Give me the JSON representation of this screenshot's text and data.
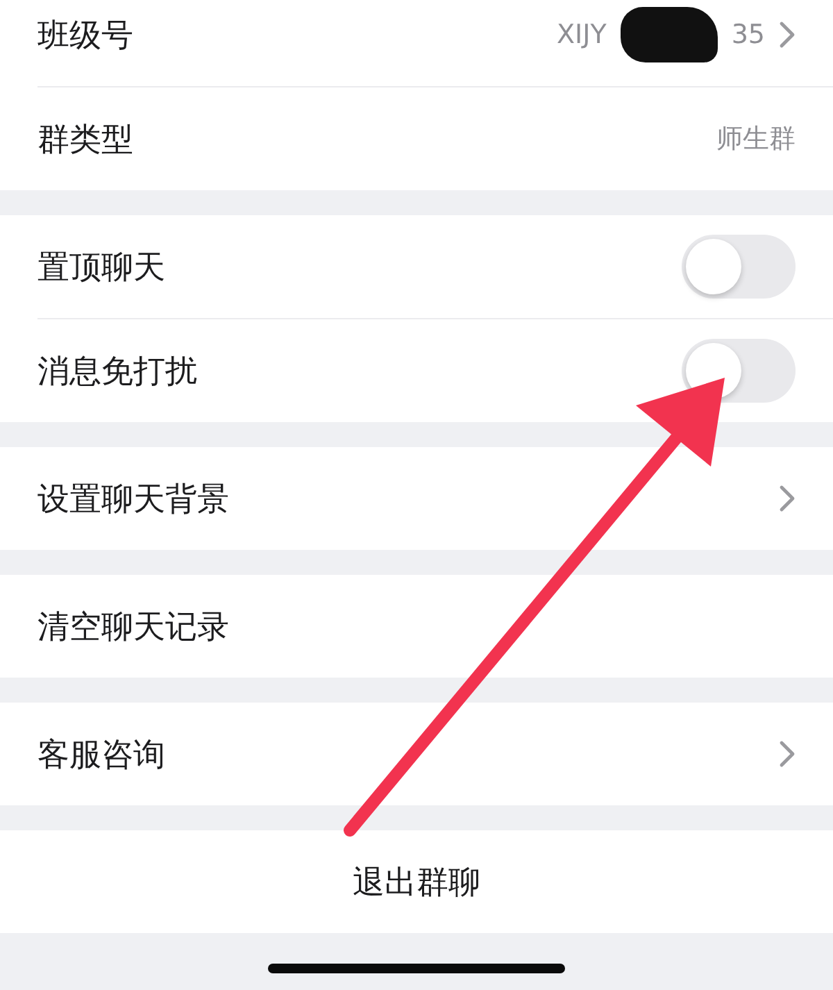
{
  "groups": [
    {
      "rows": [
        {
          "kind": "redacted",
          "label": "班级号",
          "value_start": "XIJY",
          "value_end": "35",
          "chevron": true
        },
        {
          "kind": "value",
          "label": "群类型",
          "value": "师生群",
          "chevron": false
        }
      ]
    },
    {
      "rows": [
        {
          "kind": "toggle",
          "label": "置顶聊天",
          "on": false
        },
        {
          "kind": "toggle",
          "label": "消息免打扰",
          "on": false
        }
      ]
    },
    {
      "rows": [
        {
          "kind": "value",
          "label": "设置聊天背景",
          "chevron": true
        }
      ]
    },
    {
      "rows": [
        {
          "kind": "value",
          "label": "清空聊天记录",
          "chevron": false
        }
      ]
    },
    {
      "rows": [
        {
          "kind": "value",
          "label": "客服咨询",
          "chevron": true
        }
      ]
    },
    {
      "rows": [
        {
          "kind": "action",
          "label": "退出群聊"
        }
      ]
    }
  ]
}
